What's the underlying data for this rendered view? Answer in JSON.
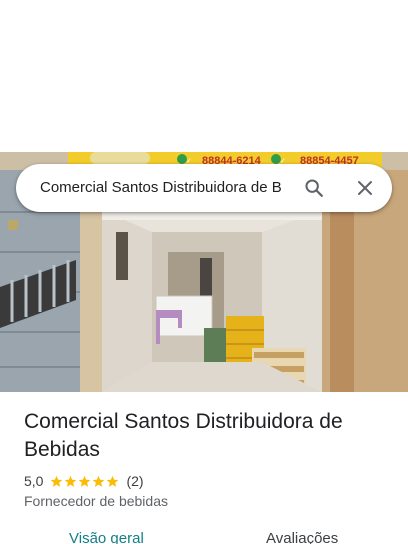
{
  "search": {
    "value": "Comercial Santos Distribuidora de B"
  },
  "photo": {
    "sign_phone_1": "88844-6214",
    "sign_phone_2": "88854-4457"
  },
  "place": {
    "title": "Comercial Santos Distribuidora de Bebidas",
    "rating": "5,0",
    "stars": 5,
    "review_count": "(2)",
    "category": "Fornecedor de bebidas"
  },
  "tabs": [
    {
      "label": "Visão geral",
      "active": true
    },
    {
      "label": "Avaliações",
      "active": false
    }
  ],
  "colors": {
    "star": "#fbbc04",
    "active_tab": "#137e86",
    "sign_yellow": "#f2cc2a",
    "sign_red": "#c0302a"
  },
  "icons": [
    "search-icon",
    "close-icon",
    "star-icon"
  ]
}
